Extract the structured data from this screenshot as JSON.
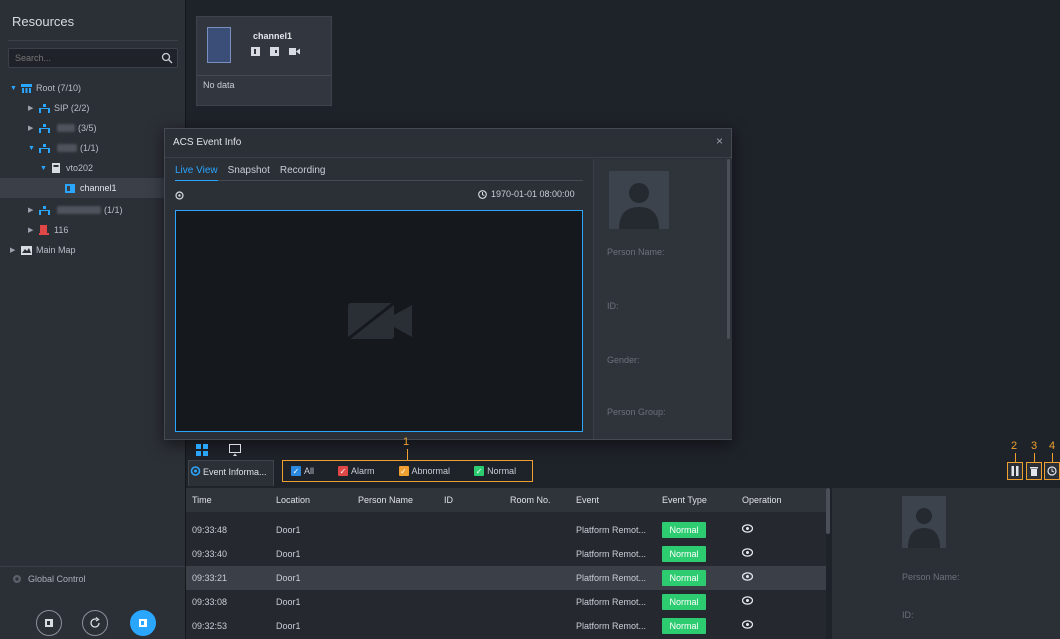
{
  "sidebar": {
    "title": "Resources",
    "search_placeholder": "Search...",
    "tree": {
      "root": "Root (7/10)",
      "sip": "SIP (2/2)",
      "group2_count": "(3/5)",
      "group3_count": "(1/1)",
      "vto": "vto202",
      "channel": "channel1",
      "group4_count": "(1/1)",
      "node116": "116",
      "main_map": "Main Map"
    },
    "global_control": "Global Control"
  },
  "channel_card": {
    "name": "channel1",
    "status": "No data"
  },
  "modal": {
    "title": "ACS Event Info",
    "close": "×",
    "tabs": [
      "Live View",
      "Snapshot",
      "Recording"
    ],
    "timestamp": "1970-01-01 08:00:00",
    "fields": {
      "person_name": "Person Name:",
      "id": "ID:",
      "gender": "Gender:",
      "person_group": "Person Group:"
    }
  },
  "annotations": [
    "1",
    "2",
    "3",
    "4"
  ],
  "event_panel": {
    "tab_label": "Event Informa...",
    "filters": [
      {
        "label": "All",
        "color": "#2b8ae0"
      },
      {
        "label": "Alarm",
        "color": "#e04848"
      },
      {
        "label": "Abnormal",
        "color": "#f0a030"
      },
      {
        "label": "Normal",
        "color": "#2ecc71"
      }
    ],
    "columns": [
      "Time",
      "Location",
      "Person Name",
      "ID",
      "Room No.",
      "Event",
      "Event Type",
      "Operation"
    ],
    "rows": [
      {
        "time": "09:33:48",
        "location": "Door1",
        "event": "Platform Remot...",
        "type": "Normal"
      },
      {
        "time": "09:33:40",
        "location": "Door1",
        "event": "Platform Remot...",
        "type": "Normal"
      },
      {
        "time": "09:33:21",
        "location": "Door1",
        "event": "Platform Remot...",
        "type": "Normal"
      },
      {
        "time": "09:33:08",
        "location": "Door1",
        "event": "Platform Remot...",
        "type": "Normal"
      },
      {
        "time": "09:32:53",
        "location": "Door1",
        "event": "Platform Remot...",
        "type": "Normal"
      }
    ],
    "detail": {
      "person_name": "Person Name:",
      "id": "ID:"
    }
  },
  "colors": {
    "accent": "#2ba6ff",
    "annotation": "#f0a030",
    "normal_tag": "#2ecc71"
  }
}
